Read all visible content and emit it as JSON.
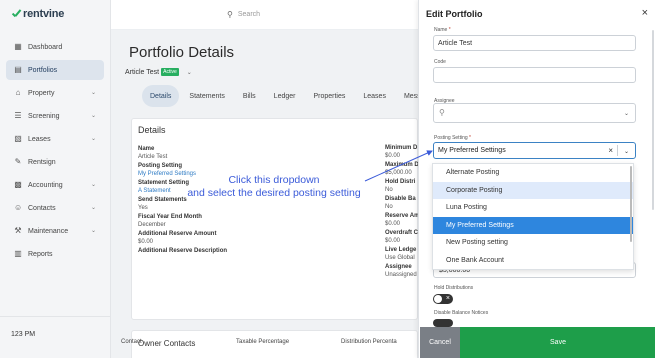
{
  "brand": {
    "name": "rentvine",
    "accent": "#27ae60"
  },
  "sidebar": {
    "items": [
      {
        "label": "Dashboard",
        "icon": "dashboard-icon",
        "has_chevron": false
      },
      {
        "label": "Portfolios",
        "icon": "portfolio-icon",
        "has_chevron": false,
        "active": true
      },
      {
        "label": "Property",
        "icon": "home-icon",
        "has_chevron": true
      },
      {
        "label": "Screening",
        "icon": "screening-icon",
        "has_chevron": true
      },
      {
        "label": "Leases",
        "icon": "lease-icon",
        "has_chevron": true
      },
      {
        "label": "Rentsign",
        "icon": "signature-icon",
        "has_chevron": false
      },
      {
        "label": "Accounting",
        "icon": "accounting-icon",
        "has_chevron": true
      },
      {
        "label": "Contacts",
        "icon": "contacts-icon",
        "has_chevron": true
      },
      {
        "label": "Maintenance",
        "icon": "wrench-icon",
        "has_chevron": true
      },
      {
        "label": "Reports",
        "icon": "reports-icon",
        "has_chevron": false
      }
    ],
    "clock": "123 PM"
  },
  "topbar": {
    "search_placeholder": "Search"
  },
  "page": {
    "title": "Portfolio Details",
    "portfolio_name": "Article Test",
    "status_badge": "Active",
    "tabs": [
      "Details",
      "Statements",
      "Bills",
      "Ledger",
      "Properties",
      "Leases",
      "Mess"
    ],
    "active_tab": "Details"
  },
  "details": {
    "title": "Details",
    "left_fields": [
      {
        "label": "Name",
        "value": "Article Test",
        "link": false
      },
      {
        "label": "Posting Setting",
        "value": "My Preferred Settings",
        "link": true
      },
      {
        "label": "Statement Setting",
        "value": "A Statement",
        "link": true
      },
      {
        "label": "Send Statements",
        "value": "Yes",
        "link": false
      },
      {
        "label": "Fiscal Year End Month",
        "value": "December",
        "link": false
      },
      {
        "label": "Additional Reserve Amount",
        "value": "$0.00",
        "link": false
      },
      {
        "label": "Additional Reserve Description",
        "value": "",
        "link": false
      }
    ],
    "right_fields": [
      {
        "label": "Minimum D",
        "value": "$0.00"
      },
      {
        "label": "Maximum D",
        "value": "$5,000.00"
      },
      {
        "label": "Hold Distri",
        "value": "No"
      },
      {
        "label": "Disable Ba",
        "value": "No"
      },
      {
        "label": "Reserve Am",
        "value": "$0.00"
      },
      {
        "label": "Overdraft C",
        "value": "$0.00"
      },
      {
        "label": "Live Ledge",
        "value": "Use Global"
      },
      {
        "label": "Assignee",
        "value": "Unassigned"
      }
    ]
  },
  "owner_contacts": {
    "title": "Owner Contacts",
    "columns": [
      "Contact",
      "Taxable Percentage",
      "Distribution Percenta"
    ]
  },
  "annotation": {
    "line1": "Click this dropdown",
    "line2": "and select the desired posting setting",
    "color": "#3b5bd9"
  },
  "drawer": {
    "title": "Edit Portfolio",
    "name_label": "Name",
    "name_required": "*",
    "name_value": "Article Test",
    "code_label": "Code",
    "code_value": "",
    "assignee_label": "Assignee",
    "posting_label": "Posting Setting",
    "posting_required": "*",
    "posting_value": "My Preferred Settings",
    "options": [
      {
        "label": "Alternate Posting",
        "state": "normal"
      },
      {
        "label": "Corporate Posting",
        "state": "hover"
      },
      {
        "label": "Luna Posting",
        "state": "normal"
      },
      {
        "label": "My Preferred Settings",
        "state": "selected"
      },
      {
        "label": "New Posting setting",
        "state": "normal"
      },
      {
        "label": "One Bank Account",
        "state": "normal"
      }
    ],
    "max_amount": "$5,000.00",
    "hold_label": "Hold Distributions",
    "disable_label": "Disable Balance Notices",
    "cancel_label": "Cancel",
    "save_label": "Save",
    "colors": {
      "select_border": "#3b82c4",
      "selected": "#2e86de",
      "hover": "#dfeafb",
      "save": "#1e9e4a",
      "cancel": "#7a7f86"
    }
  }
}
